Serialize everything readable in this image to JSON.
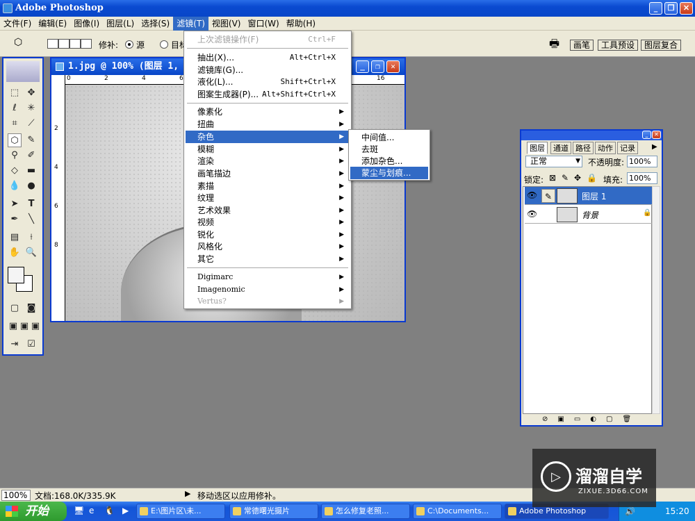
{
  "app": {
    "title": "Adobe Photoshop"
  },
  "menubar": [
    "文件(F)",
    "编辑(E)",
    "图像(I)",
    "图层(L)",
    "选择(S)",
    "滤镜(T)",
    "视图(V)",
    "窗口(W)",
    "帮助(H)"
  ],
  "options": {
    "patch_label": "修补:",
    "source_label": "源",
    "target_label": "目标"
  },
  "palette_tabs": [
    "画笔",
    "工具预设",
    "图层复合"
  ],
  "document": {
    "title": "1.jpg @ 100% (图层 1,",
    "ruler_h": [
      "0",
      "2",
      "4",
      "6",
      "16"
    ],
    "ruler_v": [
      "2",
      "4",
      "6",
      "8"
    ]
  },
  "filter_menu": {
    "items": [
      {
        "label": "上次滤镜操作(F)",
        "shortcut": "Ctrl+F",
        "disabled": true
      },
      {
        "label": "抽出(X)...",
        "shortcut": "Alt+Ctrl+X"
      },
      {
        "label": "滤镜库(G)..."
      },
      {
        "label": "液化(L)...",
        "shortcut": "Shift+Ctrl+X"
      },
      {
        "label": "图案生成器(P)...",
        "shortcut": "Alt+Shift+Ctrl+X"
      },
      {
        "label": "像素化"
      },
      {
        "label": "扭曲"
      },
      {
        "label": "杂色"
      },
      {
        "label": "模糊"
      },
      {
        "label": "渲染"
      },
      {
        "label": "画笔描边"
      },
      {
        "label": "素描"
      },
      {
        "label": "纹理"
      },
      {
        "label": "艺术效果"
      },
      {
        "label": "视频"
      },
      {
        "label": "锐化"
      },
      {
        "label": "风格化"
      },
      {
        "label": "其它"
      },
      {
        "label": "Digimarc"
      },
      {
        "label": "Imagenomic"
      },
      {
        "label": "Vertus?",
        "disabled": true
      }
    ]
  },
  "noise_submenu": [
    "中间值...",
    "去斑",
    "添加杂色...",
    "蒙尘与划痕..."
  ],
  "layers_panel": {
    "tabs": [
      "图层",
      "通道",
      "路径",
      "动作",
      "记录"
    ],
    "blend_mode": "正常",
    "opacity_label": "不透明度:",
    "opacity": "100%",
    "lock_label": "锁定:",
    "fill_label": "填充:",
    "fill": "100%",
    "layers": [
      "图层 1",
      "背景"
    ]
  },
  "status": {
    "zoom": "100%",
    "doc": "文档:168.0K/335.9K",
    "hint": "移动选区以应用修补。"
  },
  "taskbar": {
    "start": "开始",
    "tasks": [
      "E:\\图片区\\未...",
      "常德曙光摄片",
      "怎么修复老照...",
      "C:\\Documents...",
      "Adobe Photoshop"
    ],
    "clock": "15:20"
  },
  "watermark": {
    "brand": "溜溜自学",
    "url": "ZIXUE.3D66.COM"
  }
}
